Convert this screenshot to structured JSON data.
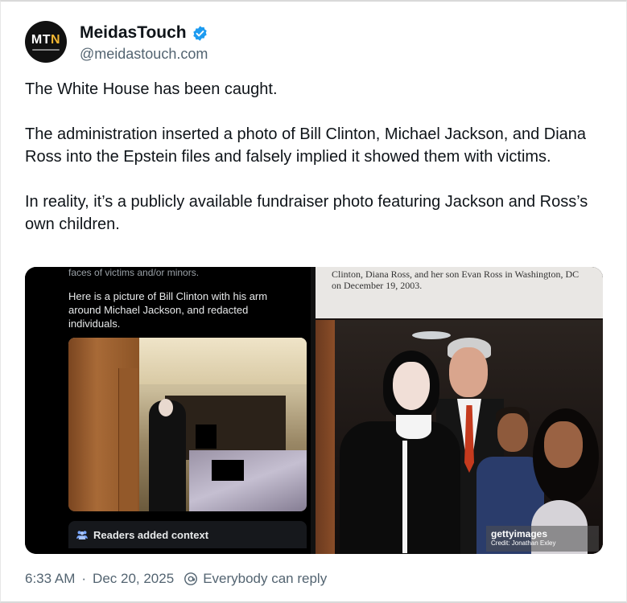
{
  "author": {
    "display_name": "MeidasTouch",
    "handle": "@meidastouch.com",
    "avatar_text": "MT",
    "avatar_text_accent": "N",
    "verified_icon": "verified-badge-icon"
  },
  "tweet": {
    "paragraphs": [
      "The White House has been caught.",
      "The administration inserted a photo of Bill Clinton, Michael Jackson, and Diana Ross into the Epstein files and falsely implied it showed them with victims.",
      "In reality, it’s a publicly available fundraiser photo featuring Jackson and Ross’s own children."
    ]
  },
  "media": {
    "left": {
      "cut_line": "faces of victims and/or minors.",
      "post_text": "Here is a picture of Bill Clinton with his arm around Michael Jackson, and redacted individuals.",
      "context_label": "Readers added context",
      "context_icon": "readers-people-icon"
    },
    "right": {
      "caption": "Clinton, Diana Ross, and her son Evan Ross in Washington, DC on December 19, 2003.",
      "watermark_brand": "gettyimages",
      "watermark_credit": "Credit: Jonathan Exley"
    }
  },
  "meta": {
    "time": "6:33 AM",
    "separator": "·",
    "date": "Dec 20, 2025",
    "reply_setting": "Everybody can reply",
    "reply_icon": "globe-at-icon"
  },
  "colors": {
    "verified_blue": "#1d9bf0",
    "text_primary": "#0f1419",
    "text_secondary": "#536471"
  }
}
